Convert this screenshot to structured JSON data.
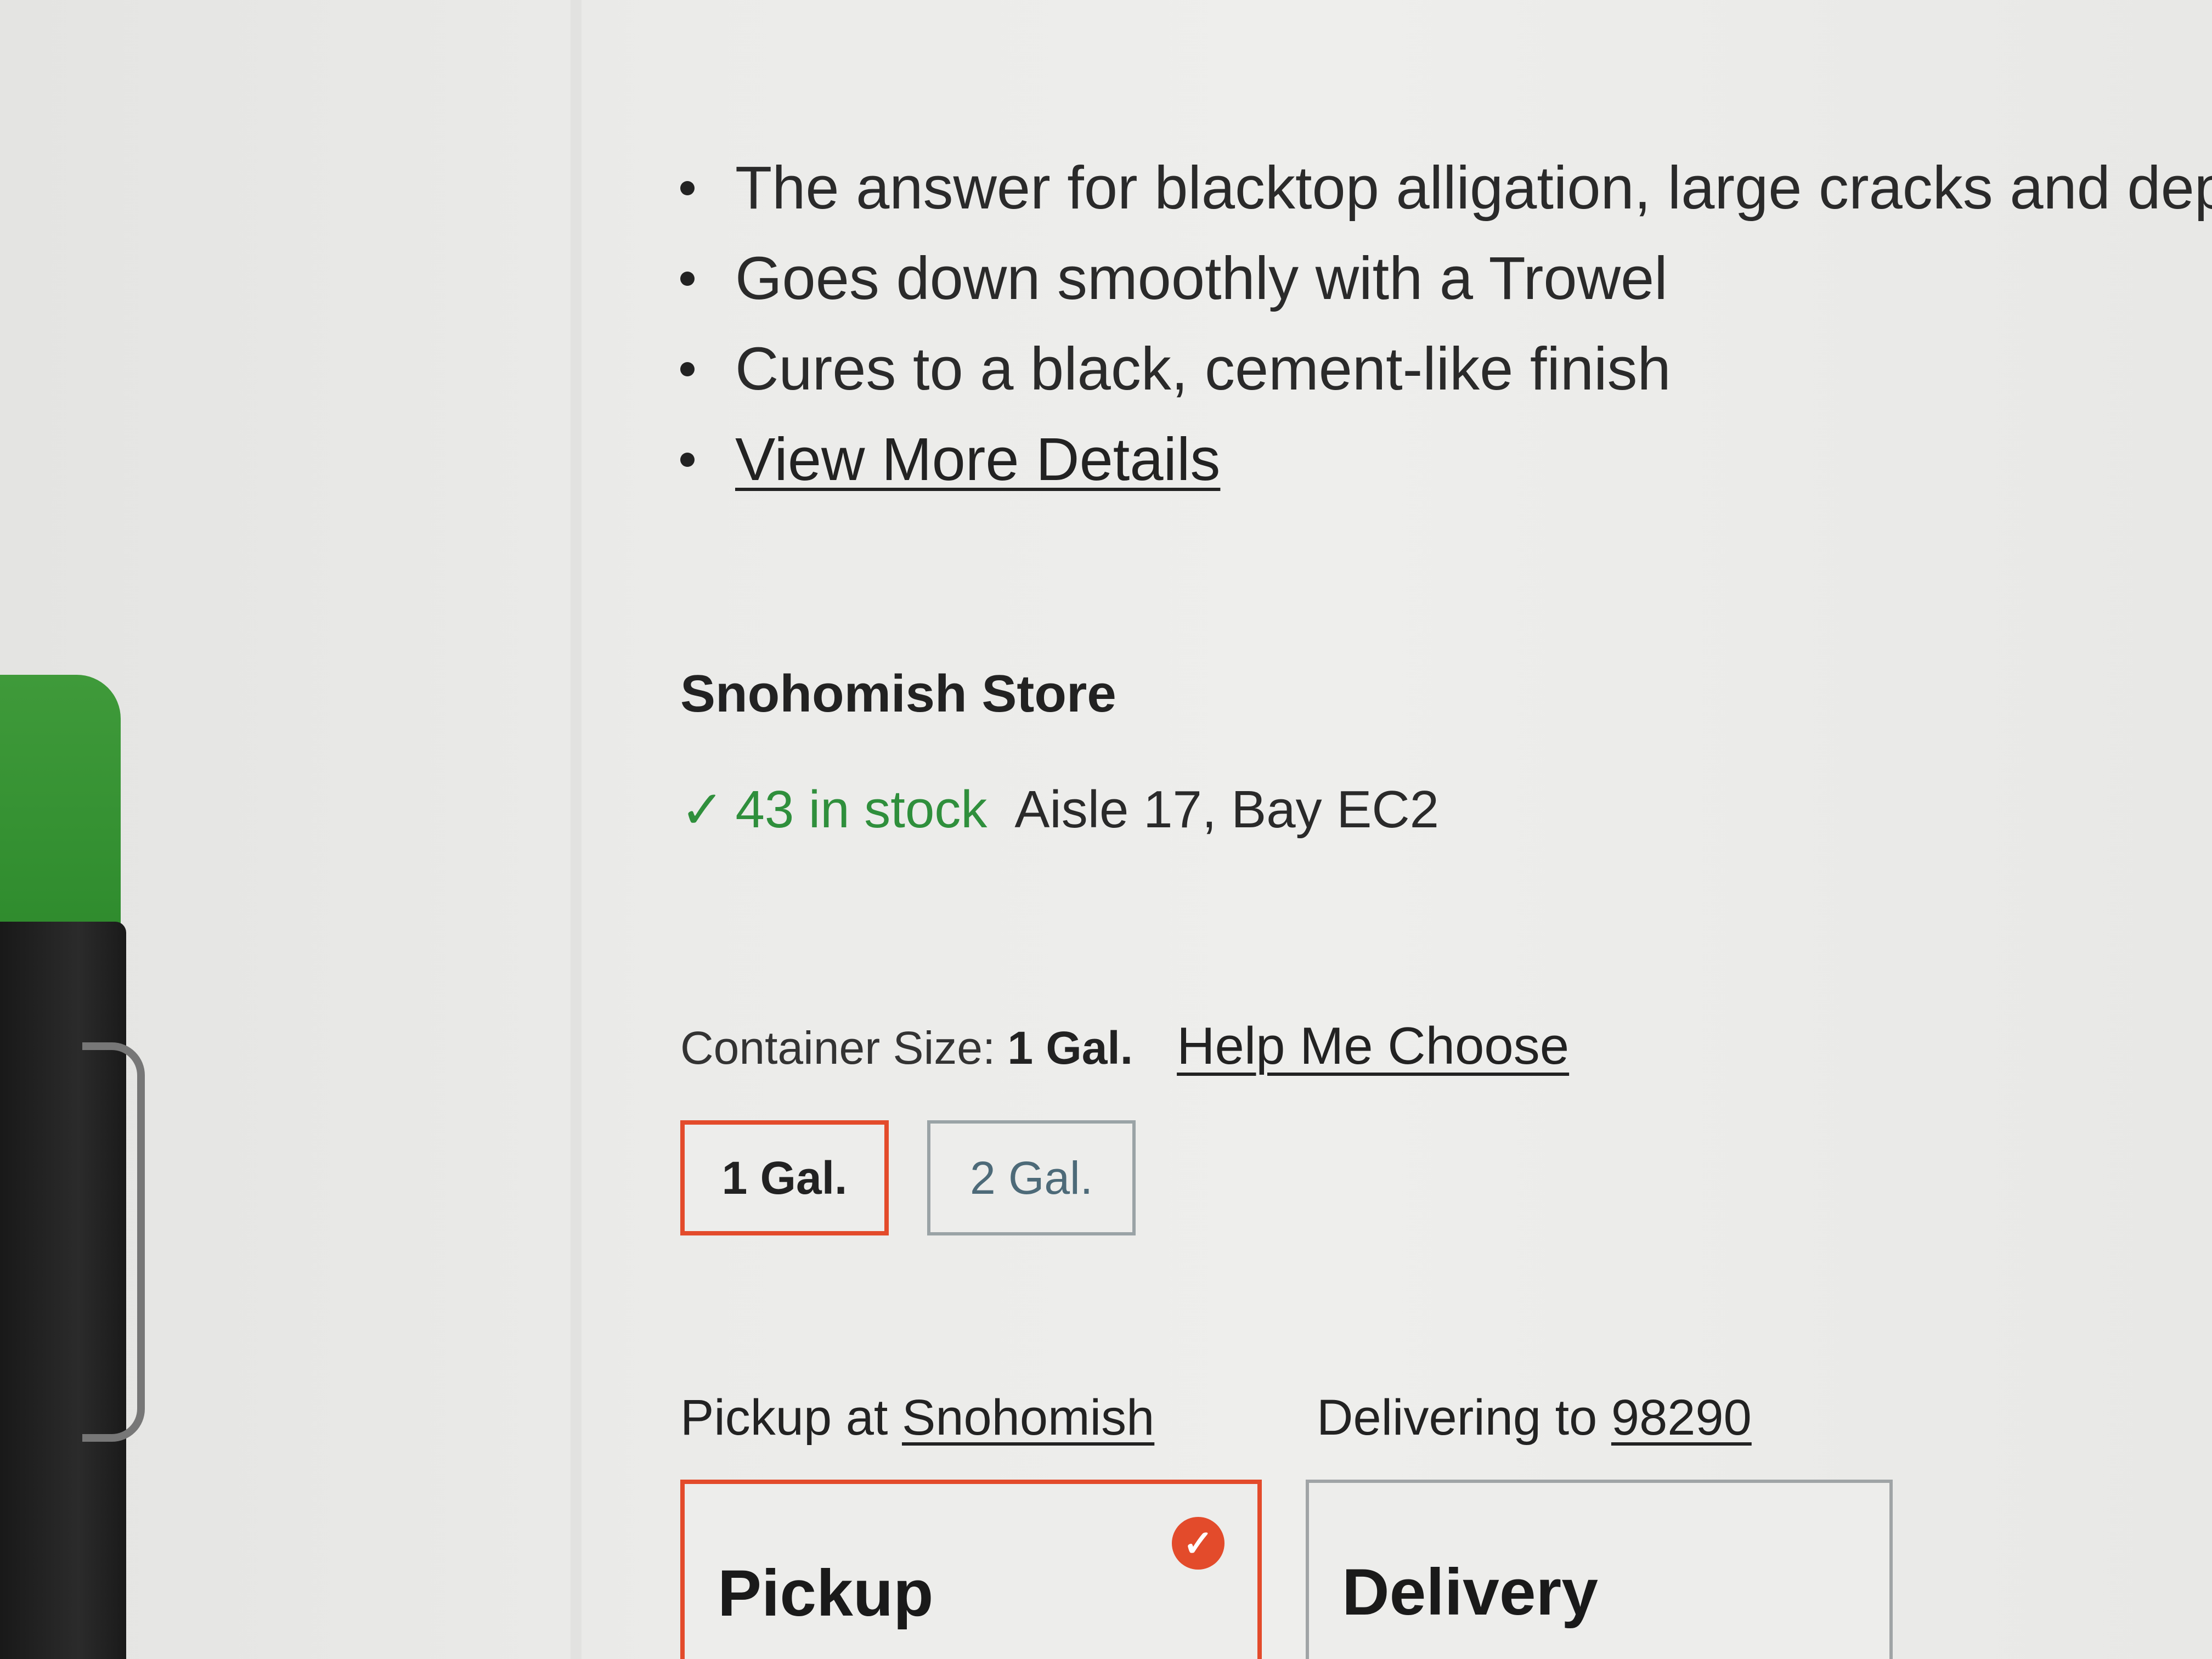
{
  "features": {
    "items": [
      "The answer for blacktop alligation, large cracks and dep",
      "Goes down smoothly with a Trowel",
      "Cures to a black, cement-like finish"
    ],
    "view_more_label": "View More Details"
  },
  "store": {
    "title": "Snohomish Store",
    "check_icon": "✓",
    "stock_text": "43 in stock",
    "aisle_text": "Aisle 17, Bay EC2",
    "stock_color": "#2f8f3c"
  },
  "container": {
    "label": "Container Size:",
    "selected_value": "1 Gal.",
    "help_link": "Help Me Choose",
    "options": [
      "1 Gal.",
      "2 Gal."
    ]
  },
  "fulfillment": {
    "pickup_prefix": "Pickup at",
    "pickup_location": "Snohomish",
    "delivery_prefix": "Delivering to",
    "delivery_zip": "98290",
    "pickup_card_label": "Pickup",
    "delivery_card_label": "Delivery",
    "selected_check_icon": "✓",
    "accent_color": "#e34b2b"
  }
}
